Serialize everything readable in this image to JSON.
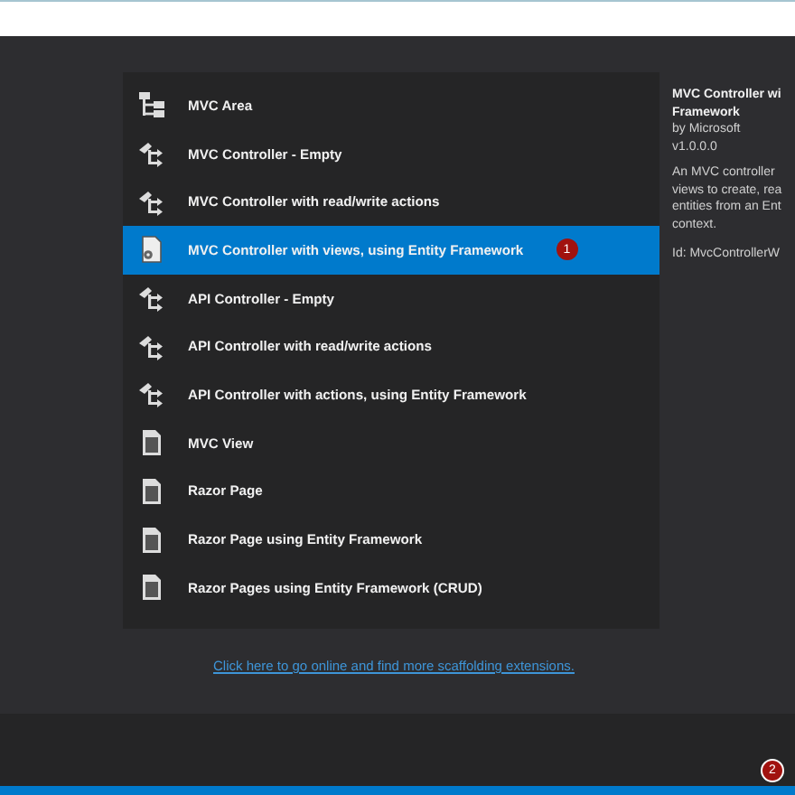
{
  "templates": [
    {
      "label": "MVC Area",
      "kind": "area",
      "selected": false
    },
    {
      "label": "MVC Controller - Empty",
      "kind": "controller",
      "selected": false
    },
    {
      "label": "MVC Controller with read/write actions",
      "kind": "controller",
      "selected": false
    },
    {
      "label": "MVC Controller with views, using Entity Framework",
      "kind": "scaffold",
      "selected": true,
      "badge": "1"
    },
    {
      "label": "API Controller - Empty",
      "kind": "controller",
      "selected": false
    },
    {
      "label": "API Controller with read/write actions",
      "kind": "controller",
      "selected": false
    },
    {
      "label": "API Controller with actions, using Entity Framework",
      "kind": "controller",
      "selected": false
    },
    {
      "label": "MVC View",
      "kind": "page",
      "selected": false
    },
    {
      "label": "Razor Page",
      "kind": "page",
      "selected": false
    },
    {
      "label": "Razor Page using Entity Framework",
      "kind": "page",
      "selected": false
    },
    {
      "label": "Razor Pages using Entity Framework (CRUD)",
      "kind": "page",
      "selected": false
    }
  ],
  "details": {
    "title_lines": [
      "MVC Controller wi",
      "Framework"
    ],
    "author": "by Microsoft",
    "version": "v1.0.0.0",
    "description_lines": [
      "An MVC controller",
      "views to create, rea",
      "entities from an Ent",
      "context."
    ],
    "id": "Id: MvcControllerW"
  },
  "link": "Click here to go online and find more scaffolding extensions.",
  "notification_badge": "2"
}
